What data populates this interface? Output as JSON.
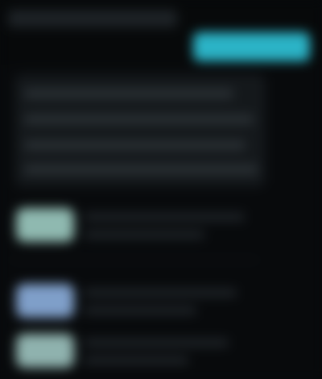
{
  "header": {
    "title": "",
    "primary_button_label": ""
  },
  "panel": {
    "lines": [
      "",
      "",
      "",
      ""
    ]
  },
  "list": {
    "items": [
      {
        "title": "",
        "subtitle": "",
        "thumbnail_color": "#8fb9b0"
      },
      {
        "title": "",
        "subtitle": "",
        "thumbnail_color": "#7f9fc9"
      },
      {
        "title": "",
        "subtitle": "",
        "thumbnail_color": "#8fb2ae"
      }
    ]
  },
  "colors": {
    "background": "#080a0c",
    "accent": "#2bb3c6",
    "panel": "#14181b"
  }
}
